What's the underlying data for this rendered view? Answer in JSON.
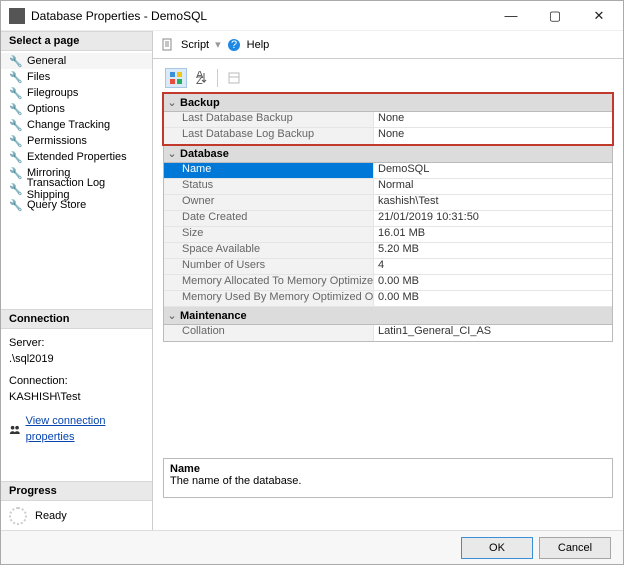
{
  "window": {
    "title": "Database Properties - DemoSQL"
  },
  "left": {
    "select_page": "Select a page",
    "pages": [
      "General",
      "Files",
      "Filegroups",
      "Options",
      "Change Tracking",
      "Permissions",
      "Extended Properties",
      "Mirroring",
      "Transaction Log Shipping",
      "Query Store"
    ],
    "connection_header": "Connection",
    "server_label": "Server:",
    "server_value": ".\\sql2019",
    "connection_label": "Connection:",
    "connection_value": "KASHISH\\Test",
    "view_conn_props": "View connection properties",
    "progress_header": "Progress",
    "progress_status": "Ready"
  },
  "toolbar": {
    "script": "Script",
    "help": "Help"
  },
  "grid": {
    "sections": {
      "backup": {
        "title": "Backup",
        "rows": [
          {
            "name": "Last Database Backup",
            "value": "None"
          },
          {
            "name": "Last Database Log Backup",
            "value": "None"
          }
        ]
      },
      "database": {
        "title": "Database",
        "rows": [
          {
            "name": "Name",
            "value": "DemoSQL",
            "selected": true
          },
          {
            "name": "Status",
            "value": "Normal"
          },
          {
            "name": "Owner",
            "value": "kashish\\Test"
          },
          {
            "name": "Date Created",
            "value": "21/01/2019 10:31:50"
          },
          {
            "name": "Size",
            "value": "16.01 MB"
          },
          {
            "name": "Space Available",
            "value": "5.20 MB"
          },
          {
            "name": "Number of Users",
            "value": "4"
          },
          {
            "name": "Memory Allocated To Memory Optimized Ob",
            "value": "0.00 MB"
          },
          {
            "name": "Memory Used By Memory Optimized Objects",
            "value": "0.00 MB"
          }
        ]
      },
      "maintenance": {
        "title": "Maintenance",
        "rows": [
          {
            "name": "Collation",
            "value": "Latin1_General_CI_AS"
          }
        ]
      }
    }
  },
  "desc": {
    "name": "Name",
    "text": "The name of the database."
  },
  "footer": {
    "ok": "OK",
    "cancel": "Cancel"
  }
}
